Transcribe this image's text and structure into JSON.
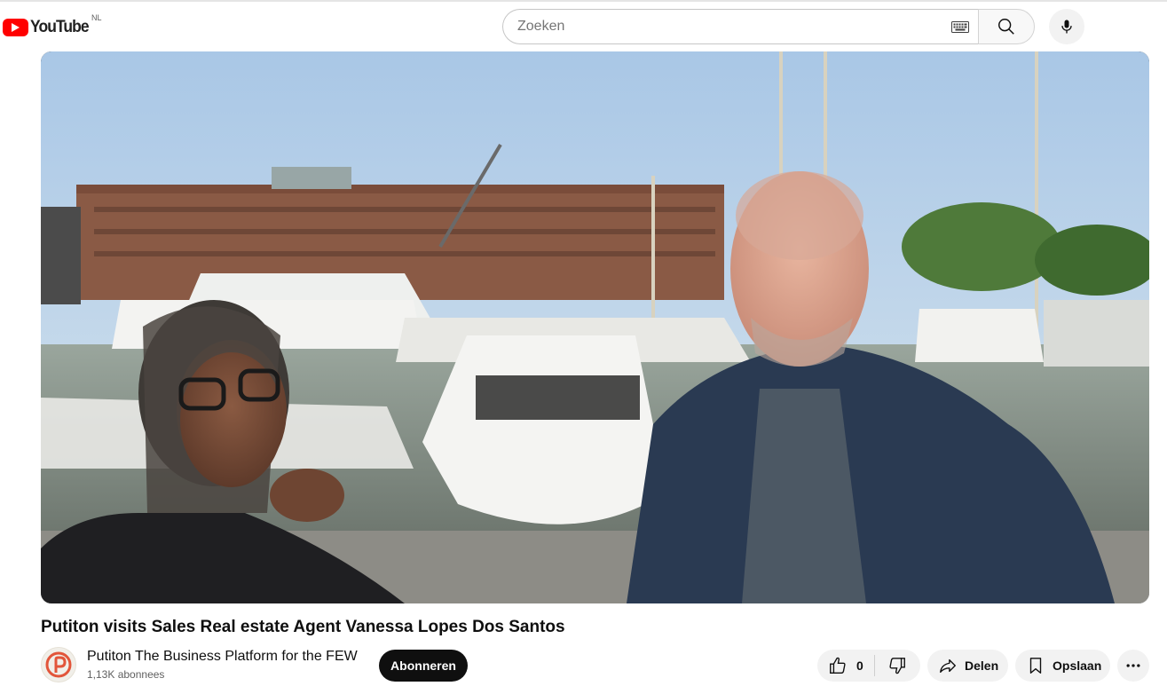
{
  "masthead": {
    "logo_text": "YouTube",
    "country_code": "NL",
    "search_placeholder": "Zoeken",
    "icons": [
      "youtube-logo-icon",
      "keyboard-icon",
      "search-icon",
      "microphone-icon"
    ]
  },
  "video": {
    "title": "Putiton visits Sales Real estate Agent Vanessa Lopes Dos Santos"
  },
  "channel": {
    "name": "Putiton The Business Platform for the FEW",
    "subscribers": "1,13K abonnees",
    "subscribe_label": "Abonneren"
  },
  "actions": {
    "like_count": "0",
    "share_label": "Delen",
    "save_label": "Opslaan",
    "icons": [
      "thumbs-up-icon",
      "thumbs-down-icon",
      "share-icon",
      "bookmark-icon",
      "more-icon"
    ]
  },
  "colors": {
    "brand_red": "#ff0000",
    "subscribe_bg": "#0f0f0f",
    "pill_bg": "#f2f2f2",
    "avatar_brand": "#e2553a"
  }
}
